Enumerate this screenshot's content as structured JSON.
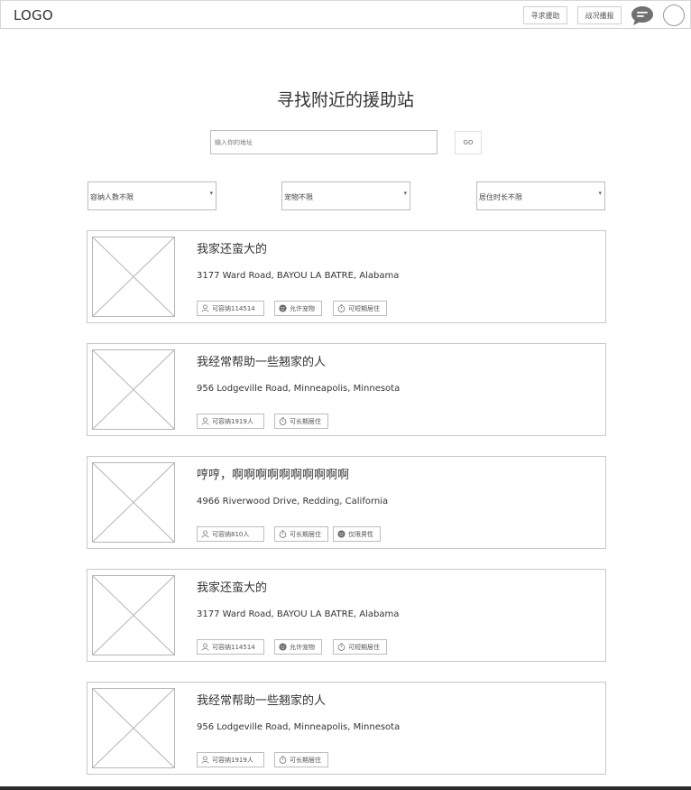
{
  "header": {
    "logo": "LOGO",
    "seek_help_label": "寻求援助",
    "report_label": "战况播报"
  },
  "main": {
    "title": "寻找附近的援助站",
    "search": {
      "placeholder": "输入你的地址",
      "go_label": "GO"
    },
    "filters": [
      {
        "label": "容纳人数不限"
      },
      {
        "label": "宠物不限"
      },
      {
        "label": "居住时长不限"
      }
    ],
    "cards": [
      {
        "title": "我家还蛮大的",
        "address": "3177 Ward Road, BAYOU LA BATRE, Alabama",
        "tags": [
          {
            "icon": "person-icon",
            "label": "可容纳114514"
          },
          {
            "icon": "face-icon",
            "label": "允许宠物"
          },
          {
            "icon": "timer-icon",
            "label": "可短期居住"
          }
        ]
      },
      {
        "title": "我经常帮助一些翘家的人",
        "address": "956 Lodgeville Road, Minneapolis, Minnesota",
        "tags": [
          {
            "icon": "person-icon",
            "label": "可容纳1919人"
          },
          {
            "icon": "timer-icon",
            "label": "可长期居住"
          }
        ]
      },
      {
        "title": "哼哼，啊啊啊啊啊啊啊啊啊啊",
        "address": "4966 Riverwood Drive, Redding, California",
        "tags": [
          {
            "icon": "person-icon",
            "label": "可容纳810人"
          },
          {
            "icon": "timer-icon",
            "label": "可长期居住"
          },
          {
            "icon": "face-icon",
            "label": "仅限男性"
          }
        ]
      },
      {
        "title": "我家还蛮大的",
        "address": "3177 Ward Road, BAYOU LA BATRE, Alabama",
        "tags": [
          {
            "icon": "person-icon",
            "label": "可容纳114514"
          },
          {
            "icon": "face-icon",
            "label": "允许宠物"
          },
          {
            "icon": "timer-icon",
            "label": "可短期居住"
          }
        ]
      },
      {
        "title": "我经常帮助一些翘家的人",
        "address": "956 Lodgeville Road, Minneapolis, Minnesota",
        "tags": [
          {
            "icon": "person-icon",
            "label": "可容纳1919人"
          },
          {
            "icon": "timer-icon",
            "label": "可长期居住"
          }
        ]
      }
    ]
  }
}
